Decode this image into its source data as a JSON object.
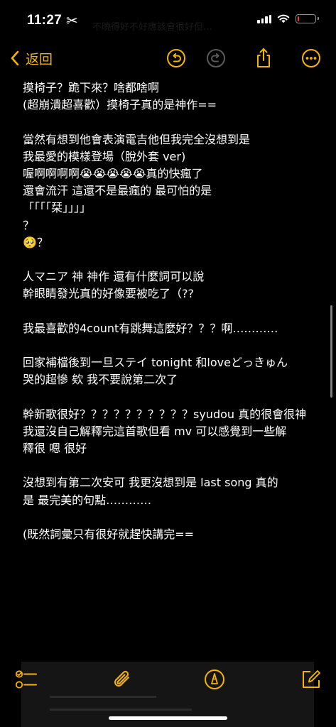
{
  "status_bar": {
    "time": "11:27",
    "time_suffix_icon": "scissors-icon",
    "battery_color": "#ff3b30",
    "battery_level": 0.08
  },
  "ghost_text": "不曉得好不好應該會很好但…",
  "nav": {
    "back_label": "返回",
    "back_icon": "chevron-left-icon",
    "undo_icon": "undo-icon",
    "redo_icon": "redo-icon",
    "share_icon": "share-icon",
    "more_icon": "ellipsis-circle-icon",
    "accent_color": "#f5b400"
  },
  "note": {
    "lines": [
      "摸椅子？跪下來？啥都啥啊",
      "(超崩潰超喜歡）摸椅子真的是神作==",
      "",
      "當然有想到他會表演電吉他但我完全沒想到是",
      "我最愛的模樣登場（脫外套 ver)",
      "喔啊啊啊啊😭😭😭😭😭真的快瘋了",
      "還會流汗 這還不是最瘋的 最可怕的是",
      "「「「「栞」」」」",
      "？",
      "🥺？",
      "",
      "人マニア 神 神作 還有什麼詞可以說",
      "幹眼睛發光真的好像要被吃了（??",
      "",
      "我最喜歡的4count有跳舞這麼好？？？啊…………",
      "",
      "回家補檔後到一旦ステイ tonight 和loveどっきゅん",
      "哭的超慘 欸 我不要說第二次了",
      "",
      "幹新歌很好？？？？？？？？？？syudou 真的很會很神",
      "我還沒自己解釋完這首歌但看 mv 可以感覺到一些解",
      "釋很 嗯 很好",
      "",
      "沒想到有第二次安可 我更沒想到是 last song 真的",
      "是 最完美的句點…………",
      "",
      "(既然詞彙只有很好就趕快講完=="
    ]
  },
  "toolbar": {
    "checklist_icon": "checklist-icon",
    "attachment_icon": "paperclip-icon",
    "markup_icon": "markup-pen-icon",
    "compose_icon": "compose-icon"
  }
}
